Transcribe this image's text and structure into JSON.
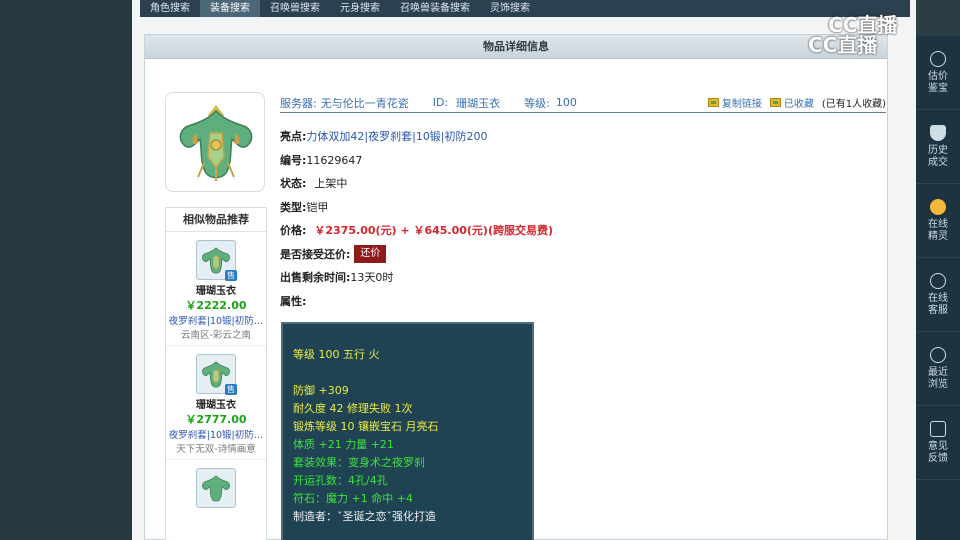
{
  "nav": {
    "tabs": [
      {
        "label": "角色搜索"
      },
      {
        "label": "装备搜索",
        "active": true
      },
      {
        "label": "召唤兽搜索"
      },
      {
        "label": "元身搜索"
      },
      {
        "label": "召唤兽装备搜索"
      },
      {
        "label": "灵饰搜索"
      }
    ]
  },
  "panel": {
    "title": "物品详细信息"
  },
  "info": {
    "server_label": "服务器:",
    "server_value": "无与伦比一青花瓷",
    "id_label": "ID:",
    "id_value": "珊瑚玉衣",
    "level_label": "等级:",
    "level_value": "100",
    "copy_link": "复制链接",
    "favorited": "已收藏",
    "fav_count": "(已有1人收藏)"
  },
  "detail": {
    "highlight_label": "亮点:",
    "highlight_value": "力体双加42|夜罗刹套|10锻|初防200",
    "serial_label": "编号:",
    "serial_value": "11629647",
    "status_label": "状态:",
    "status_value": "上架中",
    "type_label": "类型:",
    "type_value": "铠甲",
    "price_label": "价格:",
    "price_value": "￥2375.00(元) + ￥645.00(元)(跨服交易费)",
    "bargain_label": "是否接受还价:",
    "bargain_button": "还价",
    "remain_label": "出售剩余时间:",
    "remain_value": "13天0时",
    "attr_label": "属性:"
  },
  "attributes": [
    {
      "text": "等级 100 五行 火",
      "color": "yellow"
    },
    {
      "text": "",
      "color": "white"
    },
    {
      "text": "防御 +309",
      "color": "yellow"
    },
    {
      "text": "耐久度 42 修理失败 1次",
      "color": "yellow"
    },
    {
      "text": "锻炼等级 10 镶嵌宝石 月亮石",
      "color": "yellow"
    },
    {
      "text": "体质 +21 力量 +21",
      "color": "green"
    },
    {
      "text": "套装效果：变身术之夜罗刹",
      "color": "green"
    },
    {
      "text": "开运孔数：4孔/4孔",
      "color": "green"
    },
    {
      "text": "符石：魔力 +1 命中 +4",
      "color": "green"
    },
    {
      "text": "制造者：ˇ圣诞之恋ˇ强化打造",
      "color": "white"
    }
  ],
  "similar": {
    "title": "相似物品推荐",
    "sale_badge": "售",
    "items": [
      {
        "name": "珊瑚玉衣",
        "price": "￥2222.00",
        "tags": "夜罗刹套|10锻|初防…",
        "server": "云南区-彩云之南"
      },
      {
        "name": "珊瑚玉衣",
        "price": "￥2777.00",
        "tags": "夜罗刹套|10锻|初防…",
        "server": "天下无双-诗情画意"
      },
      {
        "name": "",
        "price": "",
        "tags": "",
        "server": ""
      }
    ]
  },
  "sidebar": {
    "items": [
      {
        "label": "估价鉴宝",
        "icon": "plus-icon"
      },
      {
        "label": "历史成交",
        "icon": "shield-icon"
      },
      {
        "label": "在线精灵",
        "icon": "avatar-icon"
      },
      {
        "label": "在线客服",
        "icon": "headset-icon"
      },
      {
        "label": "最近浏览",
        "icon": "clock-icon"
      },
      {
        "label": "意见反馈",
        "icon": "edit-icon"
      }
    ]
  },
  "watermark": {
    "text": "CC直播"
  },
  "colors": {
    "price_red": "#d9242c",
    "link_blue": "#2a56b3",
    "attr_bg": "#1f4353"
  }
}
